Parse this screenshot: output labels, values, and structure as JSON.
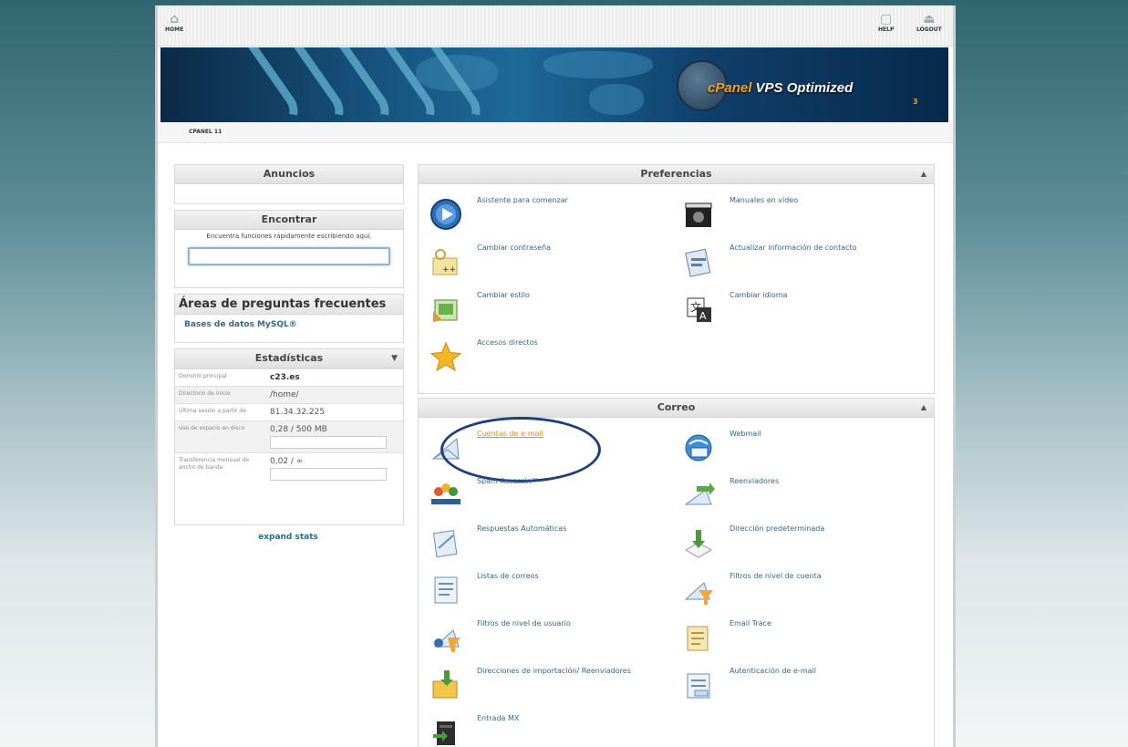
{
  "topbar": {
    "home_label": "HOME",
    "help_label": "HELP",
    "logout_label": "LOGOUT"
  },
  "banner": {
    "logo_prefix": "cPanel",
    "logo_rest": " VPS Optimized",
    "logo_sub": "3"
  },
  "subbar": {
    "label": "CPANEL 11"
  },
  "anuncios": {
    "title": "Anuncios"
  },
  "encontrar": {
    "title": "Encontrar",
    "description": "Encuentra funciones rápidamente escribiendo aquí.",
    "search_value": ""
  },
  "faq": {
    "title": "Áreas de preguntas frecuentes",
    "link": "Bases de datos MySQL®"
  },
  "stats": {
    "title": "Estadísticas",
    "rows": [
      {
        "label": "Dominio principal",
        "value": "c23.es"
      },
      {
        "label": "Directorio de inicio",
        "value": "/home/"
      },
      {
        "label": "Última sesión a partir de",
        "value": "81.34.32.225"
      },
      {
        "label": "Uso de espacio en disco",
        "value": "0,28 / 500 MB"
      },
      {
        "label": "Transferencia mensual de ancho de banda",
        "value": "0,02 / ∞"
      }
    ],
    "expand": "expand stats"
  },
  "preferencias": {
    "title": "Preferencias",
    "items": [
      {
        "label": "Asistente para comenzar",
        "icon": "play-icon"
      },
      {
        "label": "Manuales en vídeo",
        "icon": "video-camera-icon"
      },
      {
        "label": "Cambiar contraseña",
        "icon": "password-icon"
      },
      {
        "label": "Actualizar información de contacto",
        "icon": "contact-icon"
      },
      {
        "label": "Cambiar estilo",
        "icon": "style-icon"
      },
      {
        "label": "Cambiar idioma",
        "icon": "language-icon"
      },
      {
        "label": "Accesos directos",
        "icon": "star-icon"
      }
    ]
  },
  "correo": {
    "title": "Correo",
    "items": [
      {
        "label": "Cuentas de e-mail",
        "icon": "envelope-icon"
      },
      {
        "label": "Webmail",
        "icon": "webmail-icon"
      },
      {
        "label": "Spam Assassin™",
        "icon": "spamassassin-icon"
      },
      {
        "label": "Reenviadores",
        "icon": "forwarders-icon"
      },
      {
        "label": "Respuestas Automáticas",
        "icon": "autoresponder-icon"
      },
      {
        "label": "Dirección predeterminada",
        "icon": "default-address-icon"
      },
      {
        "label": "Listas de correos",
        "icon": "mailing-list-icon"
      },
      {
        "label": "Filtros de nivel de cuenta",
        "icon": "account-filter-icon"
      },
      {
        "label": "Filtros de nivel de usuario",
        "icon": "user-filter-icon"
      },
      {
        "label": "Email Trace",
        "icon": "email-trace-icon"
      },
      {
        "label": "Direcciones de importación/ Reenviadores",
        "icon": "import-icon"
      },
      {
        "label": "Autenticación de e-mail",
        "icon": "authentication-icon"
      },
      {
        "label": "Entrada MX",
        "icon": "mx-entry-icon"
      }
    ]
  },
  "colors": {
    "link": "#2f6b8a",
    "highlight": "#f08a1c",
    "annotation": "#1f3f7a"
  }
}
